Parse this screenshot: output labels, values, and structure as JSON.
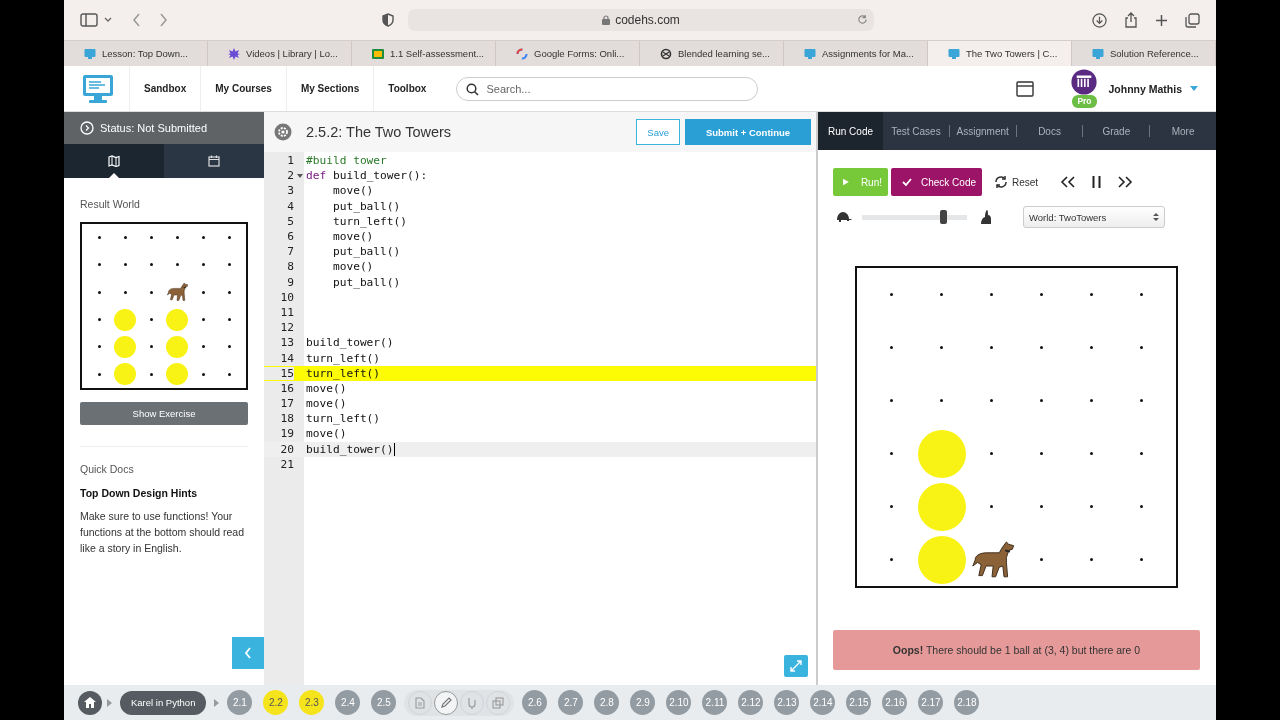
{
  "browser": {
    "url": "codehs.com",
    "tabs": [
      {
        "label": "Lesson: Top Down...",
        "kind": "codehs",
        "selected": false
      },
      {
        "label": "Videos | Library | Lo...",
        "kind": "star",
        "selected": false
      },
      {
        "label": "1.1 Self-assessment...",
        "kind": "classroom",
        "selected": false
      },
      {
        "label": "Google Forms: Onli...",
        "kind": "ring",
        "selected": false
      },
      {
        "label": "Blended learning se...",
        "kind": "knot",
        "selected": false
      },
      {
        "label": "Assignments for Ma...",
        "kind": "codehs",
        "selected": false
      },
      {
        "label": "The Two Towers | C...",
        "kind": "codehs",
        "selected": true
      },
      {
        "label": "Solution Reference...",
        "kind": "codehs",
        "selected": false
      }
    ]
  },
  "header": {
    "nav": [
      "Sandbox",
      "My Courses",
      "My Sections",
      "Toolbox"
    ],
    "search": {
      "placeholder": "Search..."
    },
    "user": {
      "name": "Johnny Mathis",
      "badge": "Pro"
    }
  },
  "sidebar": {
    "status": "Status: Not Submitted",
    "tabs": [
      {
        "kind": "map",
        "selected": true
      },
      {
        "kind": "calendar",
        "selected": false
      }
    ],
    "result_title": "Result World",
    "result_world": {
      "rows": [
        [
          {
            "kind": "dot"
          },
          {
            "kind": "dot"
          },
          {
            "kind": "dot"
          },
          {
            "kind": "dot"
          },
          {
            "kind": "dot"
          },
          {
            "kind": "dot"
          }
        ],
        [
          {
            "kind": "dot"
          },
          {
            "kind": "dot"
          },
          {
            "kind": "dot"
          },
          {
            "kind": "dot"
          },
          {
            "kind": "dot"
          },
          {
            "kind": "dot"
          }
        ],
        [
          {
            "kind": "dot"
          },
          {
            "kind": "dot"
          },
          {
            "kind": "dot"
          },
          {
            "kind": "karel"
          },
          {
            "kind": "dot"
          },
          {
            "kind": "dot"
          }
        ],
        [
          {
            "kind": "dot"
          },
          {
            "kind": "ball"
          },
          {
            "kind": "dot"
          },
          {
            "kind": "ball"
          },
          {
            "kind": "dot"
          },
          {
            "kind": "dot"
          }
        ],
        [
          {
            "kind": "dot"
          },
          {
            "kind": "ball"
          },
          {
            "kind": "dot"
          },
          {
            "kind": "ball"
          },
          {
            "kind": "dot"
          },
          {
            "kind": "dot"
          }
        ],
        [
          {
            "kind": "dot"
          },
          {
            "kind": "ball"
          },
          {
            "kind": "dot"
          },
          {
            "kind": "ball"
          },
          {
            "kind": "dot"
          },
          {
            "kind": "dot"
          }
        ]
      ]
    },
    "show_button": "Show Exercise",
    "docs_title": "Quick Docs",
    "docs_heading": "Top Down Design Hints",
    "docs_text": "Make sure to use functions! Your functions at the bottom should read like a story in English."
  },
  "editor": {
    "title": "2.5.2: The Two Towers",
    "save": "Save",
    "submit": "Submit + Continue",
    "lines": [
      {
        "number": "1",
        "segments": [
          {
            "text": "#build tower",
            "kind": "comment"
          }
        ],
        "highlighted": false,
        "current": false,
        "fold": false
      },
      {
        "number": "2",
        "segments": [
          {
            "text": "def",
            "kind": "keyword"
          },
          {
            "text": " build_tower():",
            "kind": "plain"
          }
        ],
        "highlighted": false,
        "current": false,
        "fold": true
      },
      {
        "number": "3",
        "segments": [
          {
            "text": "    move()",
            "kind": "plain"
          }
        ],
        "highlighted": false,
        "current": false,
        "fold": false
      },
      {
        "number": "4",
        "segments": [
          {
            "text": "    put_ball()",
            "kind": "plain"
          }
        ],
        "highlighted": false,
        "current": false,
        "fold": false
      },
      {
        "number": "5",
        "segments": [
          {
            "text": "    turn_left()",
            "kind": "plain"
          }
        ],
        "highlighted": false,
        "current": false,
        "fold": false
      },
      {
        "number": "6",
        "segments": [
          {
            "text": "    move()",
            "kind": "plain"
          }
        ],
        "highlighted": false,
        "current": false,
        "fold": false
      },
      {
        "number": "7",
        "segments": [
          {
            "text": "    put_ball()",
            "kind": "plain"
          }
        ],
        "highlighted": false,
        "current": false,
        "fold": false
      },
      {
        "number": "8",
        "segments": [
          {
            "text": "    move()",
            "kind": "plain"
          }
        ],
        "highlighted": false,
        "current": false,
        "fold": false
      },
      {
        "number": "9",
        "segments": [
          {
            "text": "    put_ball()",
            "kind": "plain"
          }
        ],
        "highlighted": false,
        "current": false,
        "fold": false
      },
      {
        "number": "10",
        "highlighted": false,
        "current": false,
        "fold": false
      },
      {
        "number": "11",
        "highlighted": false,
        "current": false,
        "fold": false
      },
      {
        "number": "12",
        "highlighted": false,
        "current": false,
        "fold": false
      },
      {
        "number": "13",
        "segments": [
          {
            "text": "build_tower()",
            "kind": "plain"
          }
        ],
        "highlighted": false,
        "current": false,
        "fold": false
      },
      {
        "number": "14",
        "segments": [
          {
            "text": "turn_left()",
            "kind": "plain"
          }
        ],
        "highlighted": false,
        "current": false,
        "fold": false
      },
      {
        "number": "15",
        "segments": [
          {
            "text": "turn_left()",
            "kind": "plain"
          }
        ],
        "highlighted": true,
        "current": false,
        "fold": false
      },
      {
        "number": "16",
        "segments": [
          {
            "text": "move()",
            "kind": "plain"
          }
        ],
        "highlighted": false,
        "current": false,
        "fold": false
      },
      {
        "number": "17",
        "segments": [
          {
            "text": "move()",
            "kind": "plain"
          }
        ],
        "highlighted": false,
        "current": false,
        "fold": false
      },
      {
        "number": "18",
        "segments": [
          {
            "text": "turn_left()",
            "kind": "plain"
          }
        ],
        "highlighted": false,
        "current": false,
        "fold": false
      },
      {
        "number": "19",
        "segments": [
          {
            "text": "move()",
            "kind": "plain"
          }
        ],
        "highlighted": false,
        "current": false,
        "fold": false
      },
      {
        "number": "20",
        "segments": [
          {
            "text": "build_tower()",
            "kind": "plain"
          }
        ],
        "highlighted": false,
        "current": true,
        "fold": false
      },
      {
        "number": "21",
        "highlighted": false,
        "current": false,
        "fold": false
      }
    ]
  },
  "run_panel": {
    "tabs": [
      {
        "label": "Run Code",
        "selected": true
      },
      {
        "label": "Test Cases",
        "selected": false
      },
      {
        "label": "Assignment",
        "selected": false
      },
      {
        "label": "Docs",
        "selected": false
      },
      {
        "label": "Grade",
        "selected": false
      },
      {
        "label": "More",
        "selected": false
      }
    ],
    "run": "Run!",
    "check": "Check Code",
    "reset": "Reset",
    "speed": {
      "level": 0.81
    },
    "world_select": "World: TwoTowers",
    "world": {
      "rows": [
        [
          {
            "kind": "dot"
          },
          {
            "kind": "dot"
          },
          {
            "kind": "dot"
          },
          {
            "kind": "dot"
          },
          {
            "kind": "dot"
          },
          {
            "kind": "dot"
          }
        ],
        [
          {
            "kind": "dot"
          },
          {
            "kind": "dot"
          },
          {
            "kind": "dot"
          },
          {
            "kind": "dot"
          },
          {
            "kind": "dot"
          },
          {
            "kind": "dot"
          }
        ],
        [
          {
            "kind": "dot"
          },
          {
            "kind": "dot"
          },
          {
            "kind": "dot"
          },
          {
            "kind": "dot"
          },
          {
            "kind": "dot"
          },
          {
            "kind": "dot"
          }
        ],
        [
          {
            "kind": "dot"
          },
          {
            "kind": "ball"
          },
          {
            "kind": "dot"
          },
          {
            "kind": "dot"
          },
          {
            "kind": "dot"
          },
          {
            "kind": "dot"
          }
        ],
        [
          {
            "kind": "dot"
          },
          {
            "kind": "ball"
          },
          {
            "kind": "dot"
          },
          {
            "kind": "dot"
          },
          {
            "kind": "dot"
          },
          {
            "kind": "dot"
          }
        ],
        [
          {
            "kind": "dot"
          },
          {
            "kind": "ball"
          },
          {
            "kind": "karel"
          },
          {
            "kind": "dot"
          },
          {
            "kind": "dot"
          },
          {
            "kind": "dot"
          }
        ]
      ]
    },
    "message": "**Oops!** There should be 1 ball at (3, 4) but there are 0"
  },
  "progress": {
    "course": "Karel in Python",
    "items": [
      {
        "label": "2.1",
        "complete": false
      },
      {
        "label": "2.2",
        "complete": true
      },
      {
        "label": "2.3",
        "complete": true
      },
      {
        "label": "2.4",
        "complete": false
      },
      {
        "label": "2.5",
        "complete": false,
        "expanded": true
      },
      {
        "label": "2.6",
        "complete": false
      },
      {
        "label": "2.7",
        "complete": false
      },
      {
        "label": "2.8",
        "complete": false
      },
      {
        "label": "2.9",
        "complete": false
      },
      {
        "label": "2.10",
        "complete": false
      },
      {
        "label": "2.11",
        "complete": false
      },
      {
        "label": "2.12",
        "complete": false
      },
      {
        "label": "2.13",
        "complete": false
      },
      {
        "label": "2.14",
        "complete": false
      },
      {
        "label": "2.15",
        "complete": false
      },
      {
        "label": "2.16",
        "complete": false
      },
      {
        "label": "2.17",
        "complete": false
      },
      {
        "label": "2.18",
        "complete": false
      }
    ],
    "sub_items": [
      {
        "kind": "document",
        "selected": false
      },
      {
        "kind": "pencil",
        "selected": true
      },
      {
        "kind": "hand",
        "selected": false
      },
      {
        "kind": "copy",
        "selected": false
      }
    ]
  }
}
